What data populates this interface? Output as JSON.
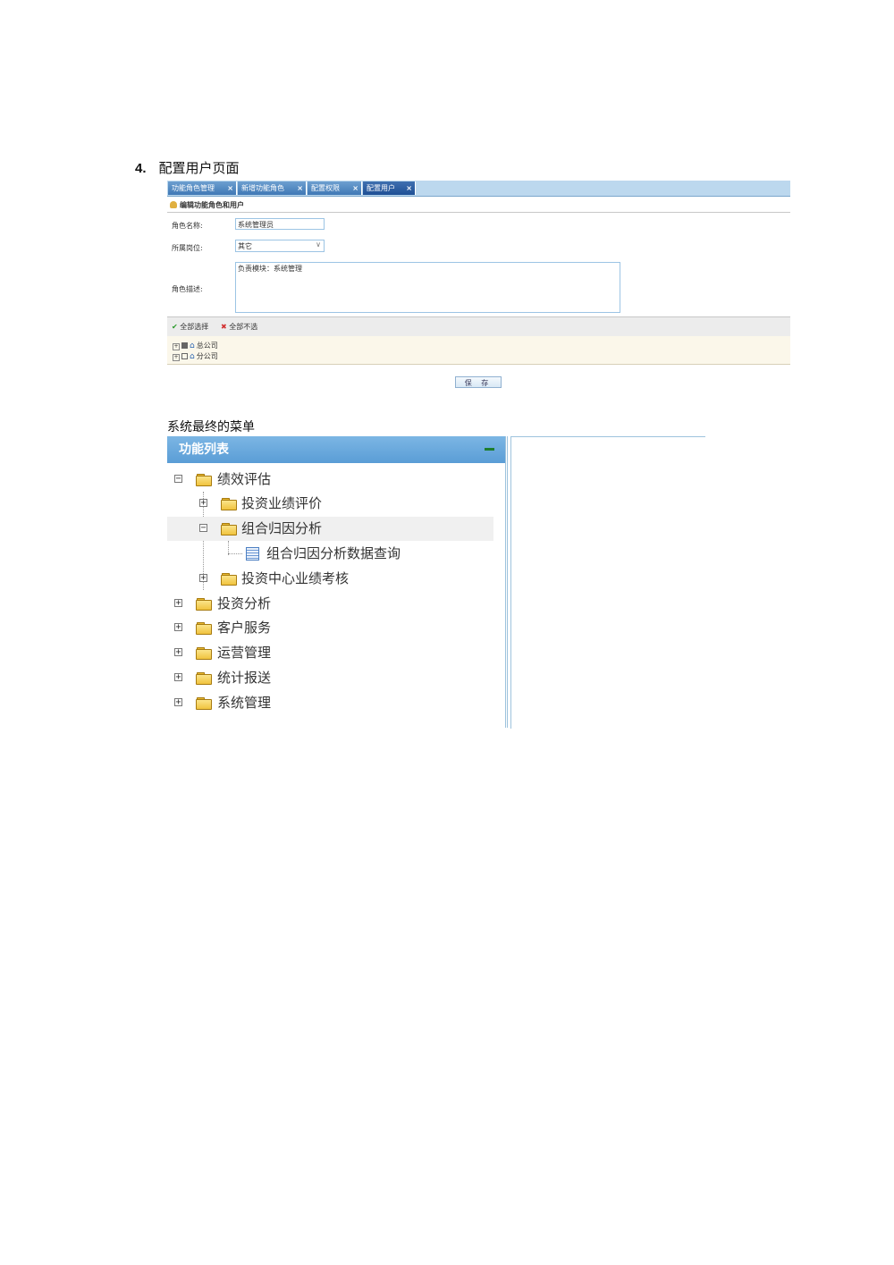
{
  "heading": {
    "number": "4.",
    "title": "配置用户页面"
  },
  "tabs": [
    {
      "label": "功能角色管理",
      "close": "×"
    },
    {
      "label": "新增功能角色",
      "close": "×"
    },
    {
      "label": "配置权限",
      "close": "×"
    },
    {
      "label": "配置用户",
      "close": "×",
      "active": true
    }
  ],
  "form": {
    "subtitle": "编辑功能角色和用户",
    "role_name_label": "角色名称:",
    "role_name_value": "系统管理员",
    "position_label": "所属岗位:",
    "position_value": "其它",
    "position_arrow": "∨",
    "desc_label": "角色描述:",
    "desc_value": "负责模块：系统管理"
  },
  "toolbar": {
    "select_all": "全部选择",
    "select_none": "全部不选"
  },
  "org_tree": [
    {
      "label": "总公司",
      "checked": true
    },
    {
      "label": "分公司",
      "checked": false
    }
  ],
  "save_label": "保 存",
  "section2_heading": "系统最终的菜单",
  "menu_panel": {
    "title": "功能列表",
    "items": [
      {
        "label": "绩效评估",
        "level": 0,
        "expander": "−"
      },
      {
        "label": "投资业绩评价",
        "level": 1,
        "expander": "+"
      },
      {
        "label": "组合归因分析",
        "level": 1,
        "expander": "−"
      },
      {
        "label": "组合归因分析数据查询",
        "level": 2,
        "expander": ""
      },
      {
        "label": "投资中心业绩考核",
        "level": 1,
        "expander": "+"
      },
      {
        "label": "投资分析",
        "level": 0,
        "expander": "+"
      },
      {
        "label": "客户服务",
        "level": 0,
        "expander": "+"
      },
      {
        "label": "运营管理",
        "level": 0,
        "expander": "+"
      },
      {
        "label": "统计报送",
        "level": 0,
        "expander": "+"
      },
      {
        "label": "系统管理",
        "level": 0,
        "expander": "+"
      }
    ]
  },
  "colors": {
    "header_blue": "#5a9dd6",
    "tab_blue": "#3f78b5",
    "folder_yellow": "#f1c33e"
  }
}
